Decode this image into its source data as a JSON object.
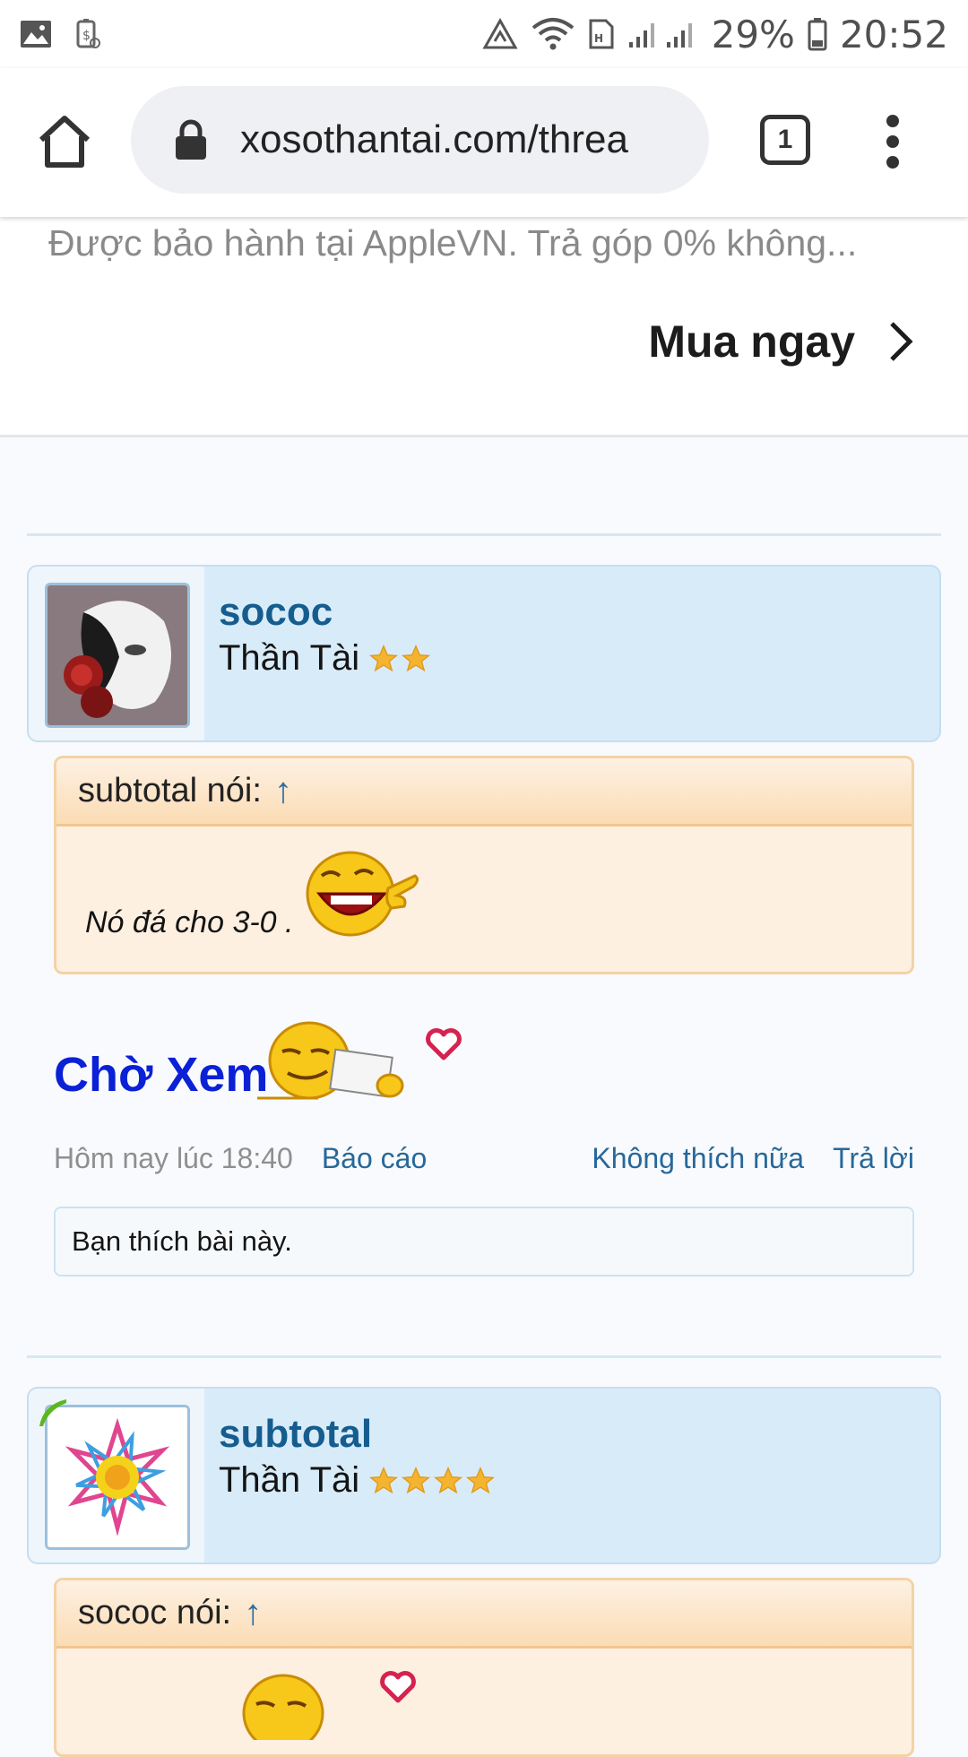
{
  "status_bar": {
    "battery": "29%",
    "time": "20:52"
  },
  "browser": {
    "url": "xosothantai.com/threa",
    "tab_count": "1"
  },
  "ad": {
    "description": "Được bảo hành tại AppleVN. Trả góp 0% không...",
    "cta": "Mua ngay"
  },
  "posts": [
    {
      "username": "sococ",
      "title": "Thần Tài",
      "stars": 2,
      "quote_header": "subtotal nói:",
      "quote_arrow": "↑",
      "quote_text": "Nó đá cho 3-0 .",
      "message": "Chờ Xem",
      "time": "Hôm nay lúc 18:40",
      "report": "Báo cáo",
      "unlike": "Không thích nữa",
      "reply": "Trả lời",
      "likes": "Bạn thích bài này."
    },
    {
      "username": "subtotal",
      "title": "Thần Tài",
      "stars": 4,
      "quote_header": "sococ nói:",
      "quote_arrow": "↑"
    }
  ],
  "colors": {
    "username": "#155d8e",
    "message": "#0a21d6",
    "link": "#27689a",
    "quote_border": "#f4d2a5"
  },
  "icons": [
    "gallery-icon",
    "battery-saver-icon",
    "data-saver-icon",
    "wifi-icon",
    "sim-icon",
    "signal-icon",
    "battery-icon",
    "home-icon",
    "lock-icon",
    "tabs-icon",
    "menu-icon",
    "chevron-right-icon",
    "star-icon",
    "laughing-smiley-icon",
    "reading-smiley-icon",
    "heart-icon"
  ]
}
